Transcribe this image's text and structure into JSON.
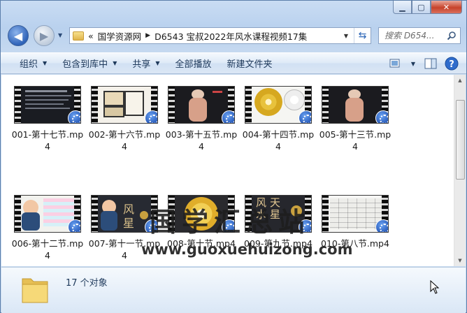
{
  "window": {
    "caption_buttons": [
      "minimize",
      "maximize",
      "close"
    ]
  },
  "address": {
    "overflow": "«",
    "crumbs": [
      "国学资源网",
      "D6543 宝叔2022年风水课程视频17集"
    ]
  },
  "search": {
    "placeholder": "搜索 D654..."
  },
  "toolbar": {
    "organize": "组织",
    "include_library": "包含到库中",
    "share": "共享",
    "play_all": "全部播放",
    "new_folder": "新建文件夹"
  },
  "files": [
    {
      "name": "001-第十七节.mp4",
      "thumb": "slide-text"
    },
    {
      "name": "002-第十六节.mp4",
      "thumb": "floorplan"
    },
    {
      "name": "003-第十五节.mp4",
      "thumb": "anatomy"
    },
    {
      "name": "004-第十四节.mp4",
      "thumb": "compass"
    },
    {
      "name": "005-第十三节.mp4",
      "thumb": "anatomy"
    },
    {
      "name": "006-第十二节.mp4",
      "thumb": "presenter"
    },
    {
      "name": "007-第十一节.mp4",
      "thumb": "presenter-title"
    },
    {
      "name": "008-第十节.mp4",
      "thumb": "compass-gold"
    },
    {
      "name": "009-第九节.mp4",
      "thumb": "title-text"
    },
    {
      "name": "010-第八节.mp4",
      "thumb": "table"
    }
  ],
  "watermark": {
    "title": "国学汇总站",
    "url": "www.guoxuehuizong.com"
  },
  "status": {
    "count": "17 个对象"
  },
  "colors": {
    "accent": "#1d4fb0",
    "toolbar_text": "#1e395b"
  }
}
